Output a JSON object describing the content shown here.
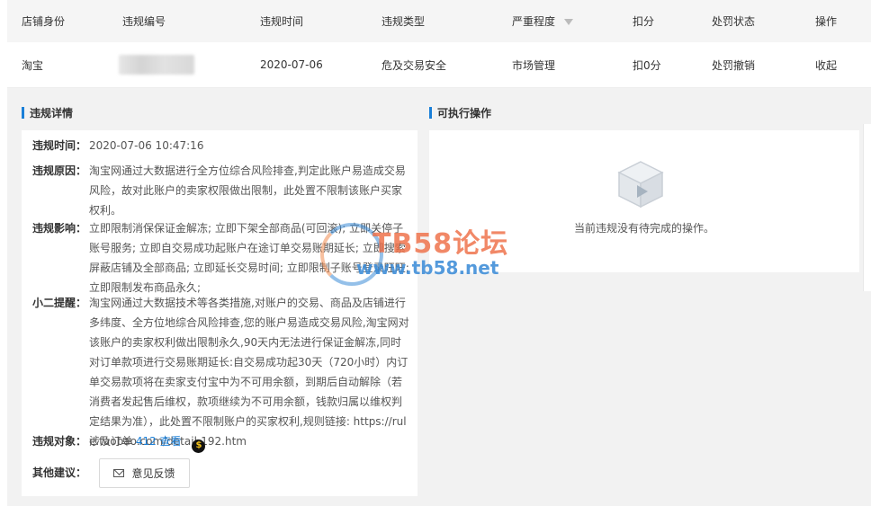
{
  "table": {
    "headers": {
      "shop_identity": "店铺身份",
      "violation_no": "违规编号",
      "violation_time": "违规时间",
      "violation_type": "违规类型",
      "severity": "严重程度",
      "deduction": "扣分",
      "penalty_status": "处罚状态",
      "operation": "操作"
    },
    "row": {
      "shop_identity": "淘宝",
      "violation_time": "2020-07-06",
      "violation_type": "危及交易安全",
      "severity": "市场管理",
      "deduction": "扣0分",
      "penalty_status": "处罚撤销",
      "operation": "收起"
    }
  },
  "detail": {
    "title": "违规详情",
    "time_label": "违规时间：",
    "time_value": "2020-07-06 10:47:16",
    "reason_label": "违规原因：",
    "reason_value": "淘宝网通过大数据进行全方位综合风险排查,判定此账户易造成交易风险，故对此账户的卖家权限做出限制，此处置不限制该账户买家权利。",
    "impact_label": "违规影响：",
    "impact_value": "立即限制消保保证金解冻; 立即下架全部商品(可回滚); 立即关停子账号服务; 立即自交易成功起账户在途订单交易账期延长; 立即搜索屏蔽店铺及全部商品; 立即延长交易时间; 立即限制子账号登录旺旺; 立即限制发布商品永久;",
    "reminder_label": "小二提醒：",
    "reminder_value": "淘宝网通过大数据技术等各类措施,对账户的交易、商品及店铺进行多纬度、全方位地综合风险排查,您的账户易造成交易风险,淘宝网对该账户的卖家权利做出限制永久,90天内无法进行保证金解冻,同时对订单款项进行交易账期延长:自交易成功起30天（720小时）内订单交易款项将在卖家支付宝中为不可用余额，到期后自动解除（若消费者发起售后维权，款项继续为不可用余额，钱款归属以维权判定结果为准），此处置不限制账户的买家权利,规则链接: https://rule.taobao.com/detail-192.htm",
    "object_label": "违规对象：",
    "object_prefix": "涉及订单",
    "object_count": "412",
    "object_link": "查看",
    "coin_symbol": "$",
    "suggestion_label": "其他建议：",
    "feedback_button": "意见反馈"
  },
  "actions": {
    "title": "可执行操作",
    "empty_text": "当前违规没有待完成的操作。"
  },
  "watermark": {
    "title": "TB58论坛",
    "url": "www.tb58.net"
  },
  "colors": {
    "accent": "#1a7fd8",
    "page_bg": "#f2f2f2",
    "header_bg": "#f5f5f5"
  }
}
